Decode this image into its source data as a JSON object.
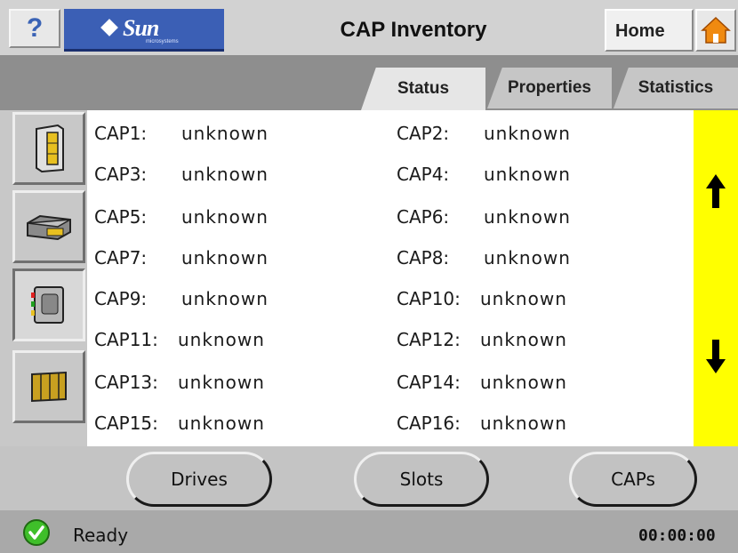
{
  "header": {
    "help_label": "?",
    "brand": "Sun",
    "brand_sub": "microsystems",
    "title": "CAP Inventory",
    "home_label": "Home"
  },
  "tabs": [
    {
      "label": "Status",
      "active": true
    },
    {
      "label": "Properties",
      "active": false
    },
    {
      "label": "Statistics",
      "active": false
    }
  ],
  "left_rail": [
    {
      "icon": "library-icon",
      "active": false
    },
    {
      "icon": "drive-icon",
      "active": false
    },
    {
      "icon": "cap-icon",
      "active": true
    },
    {
      "icon": "cartridge-icon",
      "active": false
    }
  ],
  "caps": [
    {
      "label": "CAP1:",
      "value": "unknown"
    },
    {
      "label": "CAP2:",
      "value": "unknown"
    },
    {
      "label": "CAP3:",
      "value": "unknown"
    },
    {
      "label": "CAP4:",
      "value": "unknown"
    },
    {
      "label": "CAP5:",
      "value": "unknown"
    },
    {
      "label": "CAP6:",
      "value": "unknown"
    },
    {
      "label": "CAP7:",
      "value": "unknown"
    },
    {
      "label": "CAP8:",
      "value": "unknown"
    },
    {
      "label": "CAP9:",
      "value": "unknown"
    },
    {
      "label": "CAP10:",
      "value": "unknown"
    },
    {
      "label": "CAP11:",
      "value": "unknown"
    },
    {
      "label": "CAP12:",
      "value": "unknown"
    },
    {
      "label": "CAP13:",
      "value": "unknown"
    },
    {
      "label": "CAP14:",
      "value": "unknown"
    },
    {
      "label": "CAP15:",
      "value": "unknown"
    },
    {
      "label": "CAP16:",
      "value": "unknown"
    }
  ],
  "scroll": {
    "up_icon": "arrow-up-icon",
    "down_icon": "arrow-down-icon",
    "color": "#ffff00"
  },
  "bottom_buttons": {
    "drives": "Drives",
    "slots": "Slots",
    "caps": "CAPs"
  },
  "status": {
    "text": "Ready",
    "icon": "check-icon",
    "clock": "00:00:00"
  }
}
